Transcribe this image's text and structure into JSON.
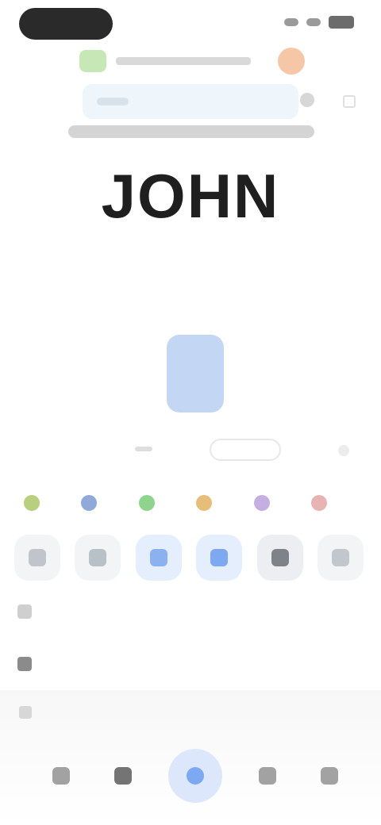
{
  "status": {
    "time": "",
    "battery": ""
  },
  "browser": {
    "url": "",
    "search_placeholder": ""
  },
  "content": {
    "headline": "JOHN",
    "subheading": "",
    "paragraph_lines": [
      "",
      "",
      "",
      ""
    ]
  },
  "controls": {
    "center_label": ""
  },
  "colors": {
    "accent_blue": "#528be2",
    "swatches": [
      "#b8cf7f",
      "#90a9d9",
      "#8fd48e",
      "#e6be7a",
      "#c5aee2",
      "#e8b3b3"
    ]
  },
  "mode_buttons": [
    {
      "name": "text-mode",
      "color": "#bfc5ca"
    },
    {
      "name": "highlight-mode",
      "color": "#b8c0c8"
    },
    {
      "name": "blue-mode",
      "color": "#8bb2ef"
    },
    {
      "name": "selection-mode",
      "color": "#7ea9f0"
    },
    {
      "name": "dark-mode",
      "color": "#7e8389"
    },
    {
      "name": "gray-mode",
      "color": "#c1c7cc"
    }
  ],
  "options": [
    {
      "label": ""
    },
    {
      "label": ""
    }
  ],
  "bottom_panel": {
    "title": ""
  }
}
